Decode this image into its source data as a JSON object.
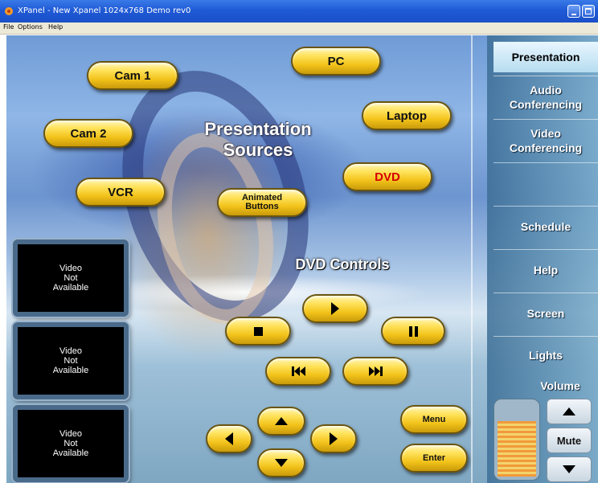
{
  "window": {
    "title": "XPanel - New Xpanel 1024x768 Demo rev0"
  },
  "menu": {
    "items": [
      "File",
      "Options",
      "Help"
    ]
  },
  "headings": {
    "sources": "Presentation Sources",
    "dvd_controls": "DVD  Controls"
  },
  "sources": {
    "cam1": "Cam 1",
    "pc": "PC",
    "cam2": "Cam 2",
    "laptop": "Laptop",
    "dvd": "DVD",
    "vcr": "VCR",
    "animated_buttons": "Animated Buttons"
  },
  "video_panels": [
    "Video\nNot\nAvailable",
    "Video\nNot\nAvailable",
    "Video\nNot\nAvailable"
  ],
  "dvd_controls": {
    "menu": "Menu",
    "enter": "Enter"
  },
  "nav": {
    "items": [
      {
        "label": "Presentation",
        "active": true
      },
      {
        "label": "Audio Conferencing",
        "active": false
      },
      {
        "label": "Video Conferencing",
        "active": false
      },
      {
        "label": "Schedule",
        "active": false
      },
      {
        "label": "Help",
        "active": false
      },
      {
        "label": "Screen",
        "active": false
      },
      {
        "label": "Lights",
        "active": false
      }
    ]
  },
  "volume": {
    "label": "Volume",
    "mute": "Mute",
    "level": 0.75
  },
  "colors": {
    "button_gold": "#f2c21a",
    "active_source": "#d40000",
    "titlebar": "#1f5ad6"
  }
}
